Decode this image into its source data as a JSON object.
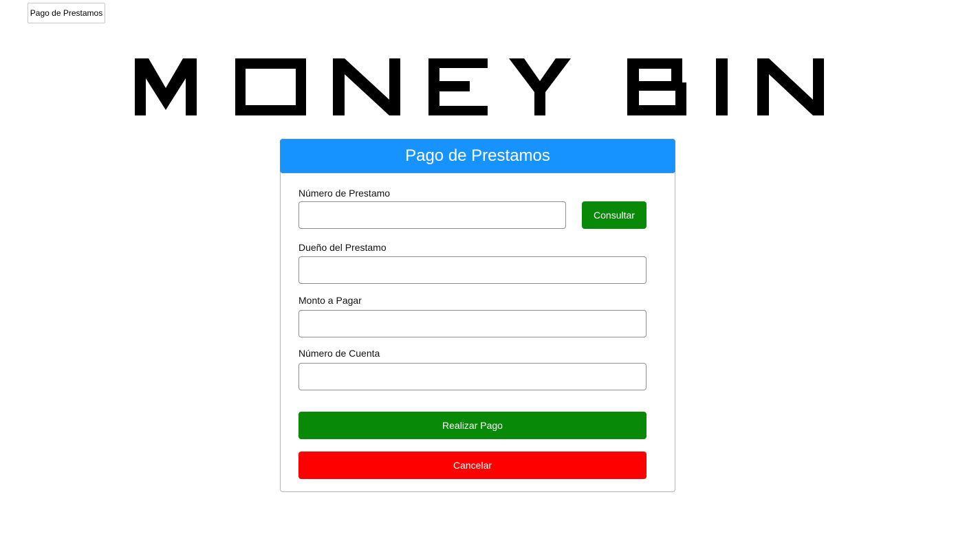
{
  "top_tab": {
    "label": "Pago de Prestamos"
  },
  "logo": {
    "text": "MONEY BIN",
    "color": "#000000"
  },
  "card": {
    "title": "Pago de Prestamos",
    "header_color": "#1793ff",
    "fields": {
      "loan_number": {
        "label": "Número de Prestamo",
        "value": "",
        "placeholder": ""
      },
      "loan_owner": {
        "label": "Dueño del Prestamo",
        "value": "",
        "placeholder": ""
      },
      "amount": {
        "label": "Monto a Pagar",
        "value": "",
        "placeholder": ""
      },
      "account_number": {
        "label": "Número de Cuenta",
        "value": "",
        "placeholder": ""
      }
    },
    "buttons": {
      "consult": "Consultar",
      "pay": "Realizar Pago",
      "cancel": "Cancelar"
    },
    "colors": {
      "success": "#088a08",
      "danger": "#ff0000"
    }
  }
}
